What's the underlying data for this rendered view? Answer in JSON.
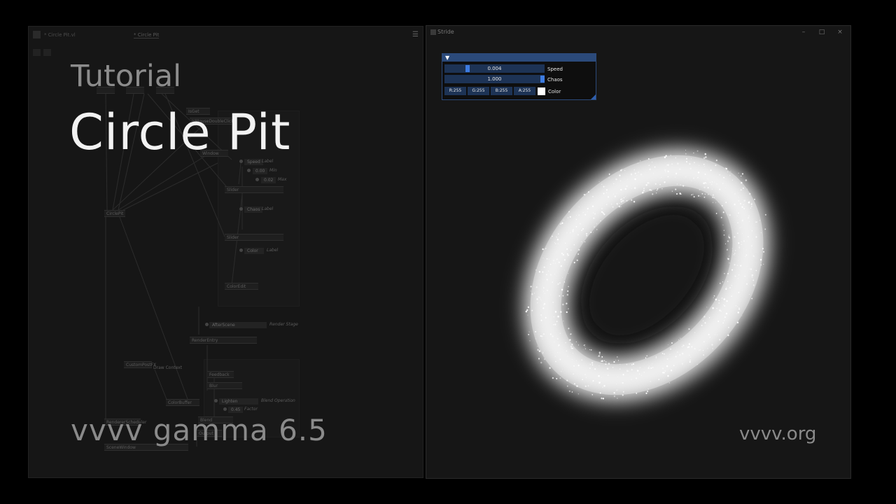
{
  "overlay": {
    "subtitle": "Tutorial",
    "title": "Circle Pit",
    "version": "vvvv gamma 6.5",
    "website": "vvvv.org"
  },
  "editor": {
    "tabs": [
      {
        "label": "* Circle Pit.vl"
      },
      {
        "label": "* Circle Pit"
      }
    ],
    "menu_icon": "hamburger-menu-icon",
    "nodes": {
      "n1": "",
      "n2": "",
      "n3": "",
      "inout": "IsGet",
      "double_click": "IsMouseDoubleClick",
      "window": "Window",
      "slider1": "Slider",
      "slider2": "Slider",
      "circlepit": "CirclePit",
      "coloredit": "ColorEdit",
      "renderentry": "RenderEntry",
      "custompostfx": "CustomPostFX",
      "drawcontext": "Draw Context",
      "feedback": "Feedback",
      "blur": "Blur",
      "colorbuffer": "ColorBuffer",
      "blend": "Blend",
      "output": "Output",
      "scenewindow": "SceneWindow",
      "rendererscheduler": "RendererScheduler"
    },
    "ioboxes": {
      "speed": "Speed",
      "min": "0.00",
      "max": "0.02",
      "chaos": "Chaos",
      "color": "Color",
      "stage": "AfterScene",
      "blend_op": "Lighten",
      "factor": "0.45"
    },
    "annotations": {
      "label1": "Label",
      "min": "Min",
      "max": "Max",
      "label2": "Label",
      "label3": "Label",
      "render_stage": "Render Stage",
      "blend_operation": "Blend Operation",
      "factor": "Factor"
    }
  },
  "stride": {
    "title": "Stride",
    "controls": {
      "minimize": "–",
      "maximize": "□",
      "close": "×"
    },
    "gui": {
      "collapse": "▼",
      "speed": {
        "value": "0.004",
        "label": "Speed",
        "fraction": 0.2
      },
      "chaos": {
        "value": "1.000",
        "label": "Chaos",
        "fraction": 1.0
      },
      "color": {
        "channels": [
          "R:255",
          "G:255",
          "B:255",
          "A:255"
        ],
        "label": "Color",
        "swatch": "#ffffff"
      }
    }
  },
  "colors": {
    "gui_accent": "#3d7be0",
    "gui_frame": "#2b4a7a",
    "particle": "#ffffff"
  }
}
